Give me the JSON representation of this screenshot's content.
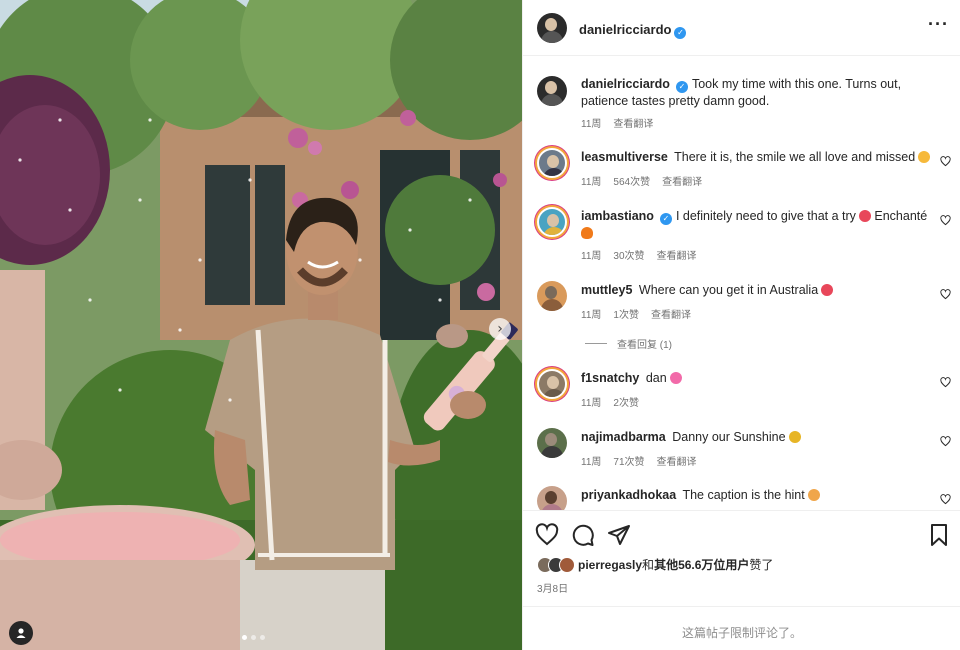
{
  "post": {
    "author": "danielricciardo",
    "caption": "Took my time with this one. Turns out, patience tastes pretty damn good.",
    "caption_age": "11周",
    "translate_label": "查看翻译",
    "liked_by_user": "pierregasly",
    "likes_joiner": "和",
    "likes_count_text": "其他56.6万位用户",
    "likes_suffix": "赞了",
    "date": "3月8日",
    "comments_restricted": "这篇帖子限制评论了。",
    "more_icon": "more-horizontal-icon",
    "carousel": {
      "slide_count": 3,
      "active_index": 0
    }
  },
  "comments": [
    {
      "user": "leasmultiverse",
      "verified": false,
      "text": "There it is, the smile we all love and missed",
      "emoji": "smile-emoji",
      "emoji_color": "#f6b93b",
      "age": "11周",
      "likes": "564次赞",
      "translate": "查看翻译",
      "story_ring": true
    },
    {
      "user": "iambastiano",
      "verified": true,
      "text": "I definitely need to give that a try",
      "emoji": "heart-eyes-emoji",
      "emoji_color": "#e8475a",
      "text2": "Enchanté",
      "line2_emoji": "fire-emoji",
      "line2_emoji_color": "#f07a1a",
      "age": "11周",
      "likes": "30次赞",
      "translate": "查看翻译",
      "story_ring": true
    },
    {
      "user": "muttley5",
      "verified": false,
      "text": "Where can you get it in Australia",
      "emoji": "heart-eyes-emoji",
      "emoji_color": "#e8475a",
      "age": "11周",
      "likes": "1次赞",
      "translate": "查看翻译",
      "story_ring": false
    },
    {
      "user": "f1snatchy",
      "verified": false,
      "text": "dan",
      "emoji": "pink-heart-emoji",
      "emoji_color": "#f26aa9",
      "age": "11周",
      "likes": "2次赞",
      "translate": "",
      "story_ring": true
    },
    {
      "user": "najimadbarma",
      "verified": false,
      "text": "Danny our Sunshine",
      "emoji": "sunflower-emoji",
      "emoji_color": "#e7b526",
      "age": "11周",
      "likes": "71次赞",
      "translate": "查看翻译",
      "story_ring": false
    },
    {
      "user": "priyankadhokaa",
      "verified": false,
      "text": "The caption is the hint",
      "emoji": "laughing-emoji",
      "emoji_color": "#f0a64a",
      "age": "",
      "likes": "",
      "translate": "",
      "story_ring": false
    }
  ],
  "replies_link": "查看回复 (1)",
  "actions": {
    "like_icon": "heart-icon",
    "comment_icon": "comment-icon",
    "share_icon": "send-icon",
    "save_icon": "bookmark-icon"
  },
  "colors": {
    "verified": "#2f97f0",
    "secondary_text": "#737373",
    "border": "#efefef"
  }
}
